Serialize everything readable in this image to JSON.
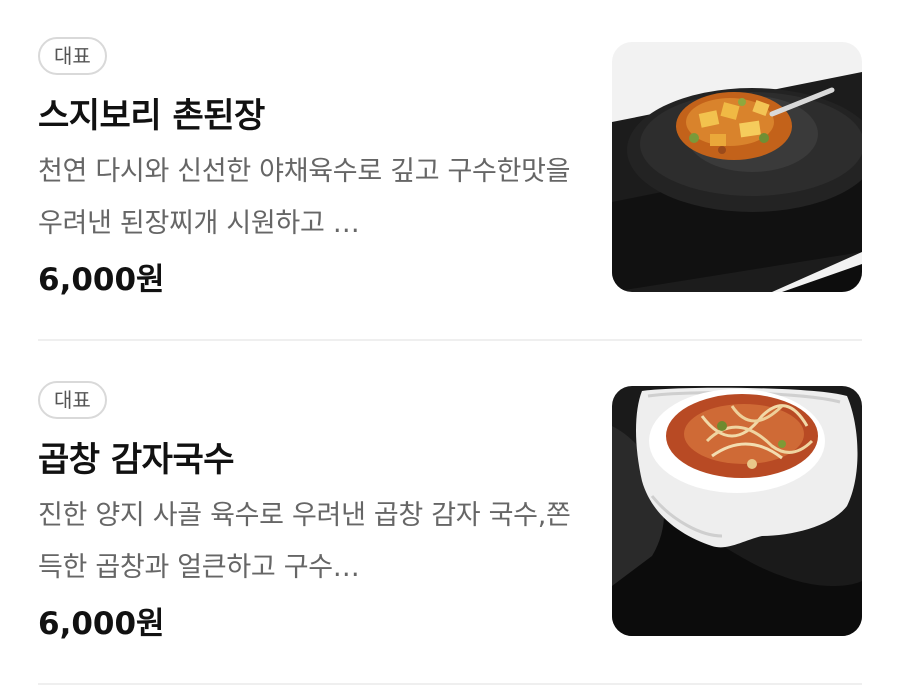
{
  "menu": {
    "items": [
      {
        "badge": "대표",
        "name": "스지보리 촌된장",
        "description": "천연 다시와 신선한 야채육수로 깊고 구수한맛을 우려낸 된장찌개 시원하고 …",
        "price": "6,000원",
        "image": "doenjang-stew-photo"
      },
      {
        "badge": "대표",
        "name": "곱창 감자국수",
        "description": "진한 양지 사골 육수로 우려낸 곱창 감자 국수,쫀득한 곱창과 얼큰하고 구수…",
        "price": "6,000원",
        "image": "gopchang-noodle-photo"
      }
    ]
  }
}
